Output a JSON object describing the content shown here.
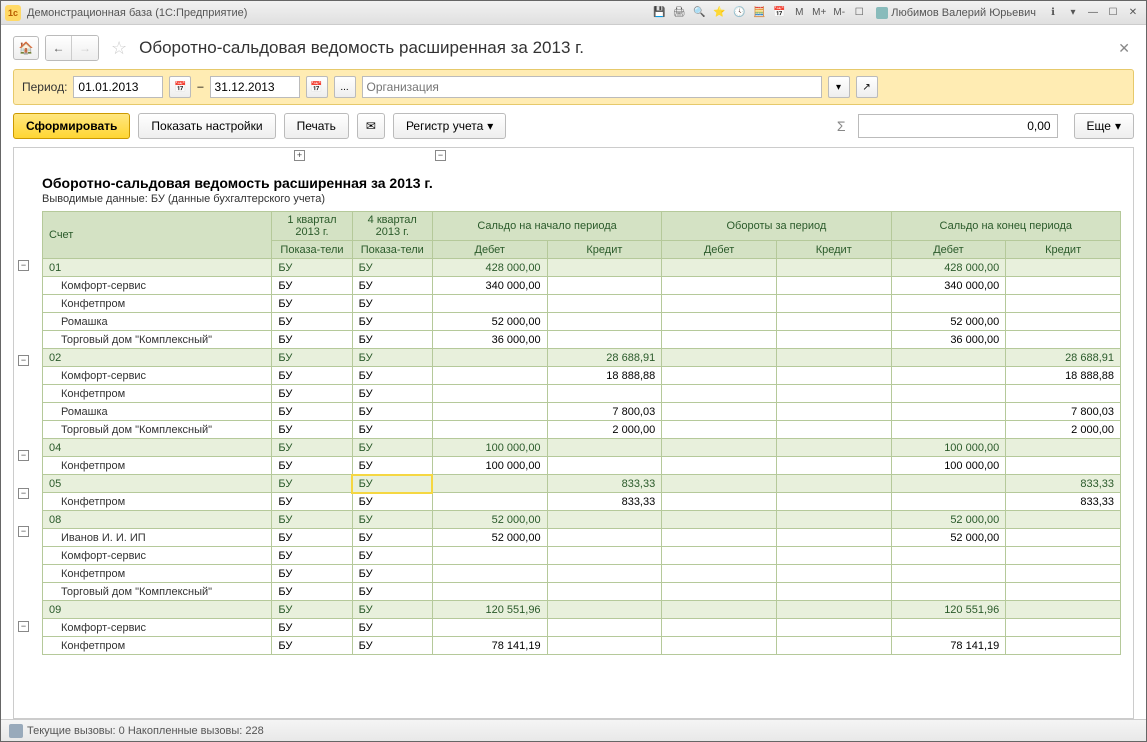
{
  "titlebar": {
    "app_title": "Демонстрационная база  (1С:Предприятие)",
    "user": "Любимов Валерий Юрьевич",
    "m_buttons": [
      "M",
      "M+",
      "M-"
    ]
  },
  "header": {
    "page_title": "Оборотно-сальдовая ведомость расширенная за 2013 г."
  },
  "filter": {
    "period_label": "Период:",
    "date_from": "01.01.2013",
    "dash": "–",
    "date_to": "31.12.2013",
    "ellipsis": "...",
    "org_placeholder": "Организация"
  },
  "toolbar": {
    "generate": "Сформировать",
    "show_settings": "Показать настройки",
    "print": "Печать",
    "registry": "Регистр учета",
    "sum_value": "0,00",
    "more": "Еще"
  },
  "report": {
    "title": "Оборотно-сальдовая ведомость расширенная за 2013 г.",
    "subtitle": "Выводимые данные:  БУ (данные бухгалтерского учета)",
    "headers": {
      "account": "Счет",
      "q1": "1 квартал 2013 г.",
      "q4": "4 квартал 2013 г.",
      "saldo_start": "Сальдо на начало периода",
      "turnover": "Обороты за период",
      "saldo_end": "Сальдо на конец периода",
      "indicators": "Показа-тели",
      "debit": "Дебет",
      "credit": "Кредит"
    },
    "rows": [
      {
        "t": "g",
        "acct": "01",
        "q1": "БУ",
        "q4": "БУ",
        "sd": "428 000,00",
        "sc": "",
        "td": "",
        "tc": "",
        "ed": "428 000,00",
        "ec": ""
      },
      {
        "t": "s",
        "acct": "Комфорт-сервис",
        "q1": "БУ",
        "q4": "БУ",
        "sd": "340 000,00",
        "sc": "",
        "td": "",
        "tc": "",
        "ed": "340 000,00",
        "ec": ""
      },
      {
        "t": "s",
        "acct": "Конфетпром",
        "q1": "БУ",
        "q4": "БУ",
        "sd": "",
        "sc": "",
        "td": "",
        "tc": "",
        "ed": "",
        "ec": ""
      },
      {
        "t": "s",
        "acct": "Ромашка",
        "q1": "БУ",
        "q4": "БУ",
        "sd": "52 000,00",
        "sc": "",
        "td": "",
        "tc": "",
        "ed": "52 000,00",
        "ec": ""
      },
      {
        "t": "s",
        "acct": "Торговый дом \"Комплексный\"",
        "q1": "БУ",
        "q4": "БУ",
        "sd": "36 000,00",
        "sc": "",
        "td": "",
        "tc": "",
        "ed": "36 000,00",
        "ec": ""
      },
      {
        "t": "g",
        "acct": "02",
        "q1": "БУ",
        "q4": "БУ",
        "sd": "",
        "sc": "28 688,91",
        "td": "",
        "tc": "",
        "ed": "",
        "ec": "28 688,91"
      },
      {
        "t": "s",
        "acct": "Комфорт-сервис",
        "q1": "БУ",
        "q4": "БУ",
        "sd": "",
        "sc": "18 888,88",
        "td": "",
        "tc": "",
        "ed": "",
        "ec": "18 888,88"
      },
      {
        "t": "s",
        "acct": "Конфетпром",
        "q1": "БУ",
        "q4": "БУ",
        "sd": "",
        "sc": "",
        "td": "",
        "tc": "",
        "ed": "",
        "ec": ""
      },
      {
        "t": "s",
        "acct": "Ромашка",
        "q1": "БУ",
        "q4": "БУ",
        "sd": "",
        "sc": "7 800,03",
        "td": "",
        "tc": "",
        "ed": "",
        "ec": "7 800,03"
      },
      {
        "t": "s",
        "acct": "Торговый дом \"Комплексный\"",
        "q1": "БУ",
        "q4": "БУ",
        "sd": "",
        "sc": "2 000,00",
        "td": "",
        "tc": "",
        "ed": "",
        "ec": "2 000,00"
      },
      {
        "t": "g",
        "acct": "04",
        "q1": "БУ",
        "q4": "БУ",
        "sd": "100 000,00",
        "sc": "",
        "td": "",
        "tc": "",
        "ed": "100 000,00",
        "ec": ""
      },
      {
        "t": "s",
        "acct": "Конфетпром",
        "q1": "БУ",
        "q4": "БУ",
        "sd": "100 000,00",
        "sc": "",
        "td": "",
        "tc": "",
        "ed": "100 000,00",
        "ec": ""
      },
      {
        "t": "g",
        "acct": "05",
        "q1": "БУ",
        "q4": "БУ",
        "sd": "",
        "sc": "833,33",
        "td": "",
        "tc": "",
        "ed": "",
        "ec": "833,33",
        "hl": true
      },
      {
        "t": "s",
        "acct": "Конфетпром",
        "q1": "БУ",
        "q4": "БУ",
        "sd": "",
        "sc": "833,33",
        "td": "",
        "tc": "",
        "ed": "",
        "ec": "833,33"
      },
      {
        "t": "g",
        "acct": "08",
        "q1": "БУ",
        "q4": "БУ",
        "sd": "52 000,00",
        "sc": "",
        "td": "",
        "tc": "",
        "ed": "52 000,00",
        "ec": ""
      },
      {
        "t": "s",
        "acct": "Иванов И. И. ИП",
        "q1": "БУ",
        "q4": "БУ",
        "sd": "52 000,00",
        "sc": "",
        "td": "",
        "tc": "",
        "ed": "52 000,00",
        "ec": ""
      },
      {
        "t": "s",
        "acct": "Комфорт-сервис",
        "q1": "БУ",
        "q4": "БУ",
        "sd": "",
        "sc": "",
        "td": "",
        "tc": "",
        "ed": "",
        "ec": ""
      },
      {
        "t": "s",
        "acct": "Конфетпром",
        "q1": "БУ",
        "q4": "БУ",
        "sd": "",
        "sc": "",
        "td": "",
        "tc": "",
        "ed": "",
        "ec": ""
      },
      {
        "t": "s",
        "acct": "Торговый дом \"Комплексный\"",
        "q1": "БУ",
        "q4": "БУ",
        "sd": "",
        "sc": "",
        "td": "",
        "tc": "",
        "ed": "",
        "ec": ""
      },
      {
        "t": "g",
        "acct": "09",
        "q1": "БУ",
        "q4": "БУ",
        "sd": "120 551,96",
        "sc": "",
        "td": "",
        "tc": "",
        "ed": "120 551,96",
        "ec": ""
      },
      {
        "t": "s",
        "acct": "Комфорт-сервис",
        "q1": "БУ",
        "q4": "БУ",
        "sd": "",
        "sc": "",
        "td": "",
        "tc": "",
        "ed": "",
        "ec": ""
      },
      {
        "t": "s",
        "acct": "Конфетпром",
        "q1": "БУ",
        "q4": "БУ",
        "sd": "78 141,19",
        "sc": "",
        "td": "",
        "tc": "",
        "ed": "78 141,19",
        "ec": ""
      }
    ]
  },
  "status": {
    "text": "Текущие вызовы: 0   Накопленные вызовы: 228"
  }
}
